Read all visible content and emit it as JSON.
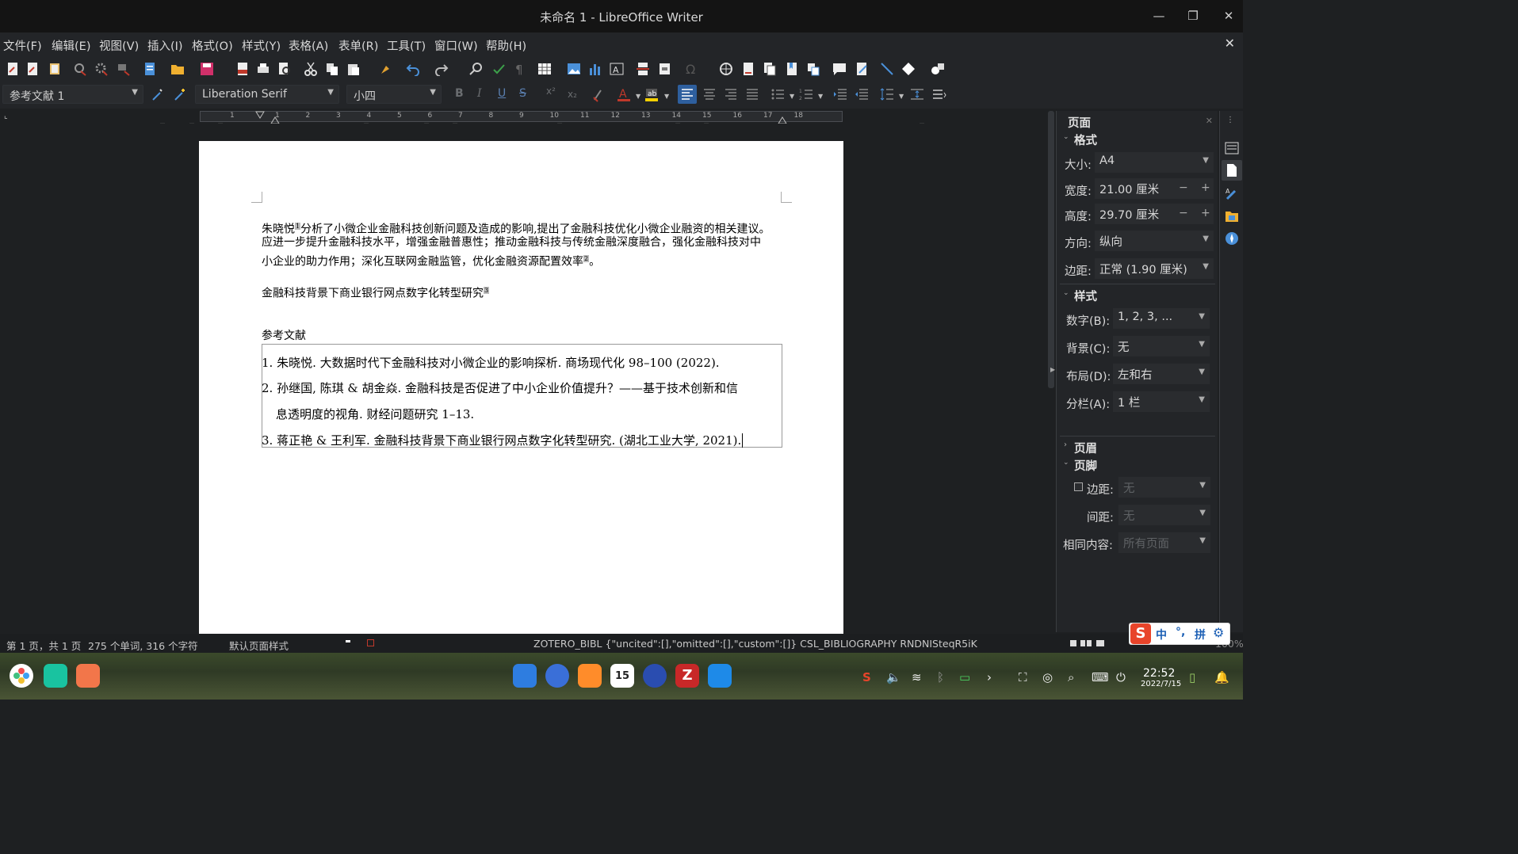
{
  "window": {
    "title": "未命名 1 - LibreOffice Writer"
  },
  "menu": [
    "文件(F)",
    "编辑(E)",
    "视图(V)",
    "插入(I)",
    "格式(O)",
    "样式(Y)",
    "表格(A)",
    "表单(R)",
    "工具(T)",
    "窗口(W)",
    "帮助(H)"
  ],
  "format_bar": {
    "para_style": "参考文献 1",
    "font_name": "Liberation Serif",
    "font_size": "小四"
  },
  "ruler": {
    "ticks": [
      "1",
      "1",
      "2",
      "3",
      "4",
      "5",
      "6",
      "7",
      "8",
      "9",
      "10",
      "11",
      "12",
      "13",
      "14",
      "15",
      "16",
      "17",
      "18"
    ]
  },
  "document": {
    "p1_line1_a": "朱晓悦",
    "p1_cite1": "1",
    "p1_line1_b": "分析了小微企业金融科技创新问题及造成的影响,提出了金融科技优化小微企业融资的相关建议。",
    "p1_line2": "应进一步提升金融科技水平，增强金融普惠性；推动金融科技与传统金融深度融合，强化金融科技对中",
    "p1_line3": "小企业的助力作用；深化互联网金融监管，优化金融资源配置效率",
    "p1_cite2": "2",
    "p1_end": "。",
    "p2_text": "金融科技背景下商业银行网点数字化转型研究",
    "p2_cite": "3",
    "bib_heading": "参考文献",
    "bib": [
      {
        "num": "1.",
        "line1": "朱晓悦. 大数据时代下金融科技对小微企业的影响探析. 商场现代化 98–100 (2022)."
      },
      {
        "num": "2.",
        "line1": "孙继国, 陈琪 & 胡金焱. 金融科技是否促进了中小企业价值提升？——基于技术创新和信",
        "line2": "息透明度的视角. 财经问题研究 1–13."
      },
      {
        "num": "3.",
        "line1": "蒋正艳 & 王利军. 金融科技背景下商业银行网点数字化转型研究. (湖北工业大学, 2021)."
      }
    ]
  },
  "sidebar": {
    "deck_title": "页面",
    "format": {
      "header": "格式",
      "size_label": "大小:",
      "size_value": "A4",
      "width_label": "宽度:",
      "width_value": "21.00 厘米",
      "height_label": "高度:",
      "height_value": "29.70 厘米",
      "orient_label": "方向:",
      "orient_value": "纵向",
      "margin_label": "边距:",
      "margin_value": "正常 (1.90 厘米)"
    },
    "styles": {
      "header": "样式",
      "num_label": "数字(B):",
      "num_value": "1, 2, 3, ...",
      "bg_label": "背景(C):",
      "bg_value": "无",
      "layout_label": "布局(D):",
      "layout_value": "左和右",
      "cols_label": "分栏(A):",
      "cols_value": "1 栏"
    },
    "header_section": "页眉",
    "footer": {
      "header": "页脚",
      "margin_label": "边距:",
      "margin_value": "无",
      "spacing_label": "间距:",
      "spacing_value": "无",
      "same_label": "相同内容:",
      "same_value": "所有页面"
    }
  },
  "status": {
    "page": "第 1 页，共 1 页",
    "words": "275 个单词, 316 个字符",
    "page_style": "默认页面样式",
    "field": "ZOTERO_BIBL {\"uncited\":[],\"omitted\":[],\"custom\":[]} CSL_BIBLIOGRAPHY RNDNISteqR5iK",
    "zoom": "100%"
  },
  "ime": {
    "logo": "S",
    "lang": "中",
    "punct": "°,",
    "mode": "拼"
  },
  "taskbar": {
    "time": "22:52",
    "date": "2022/7/15",
    "calendar_day": "15"
  }
}
